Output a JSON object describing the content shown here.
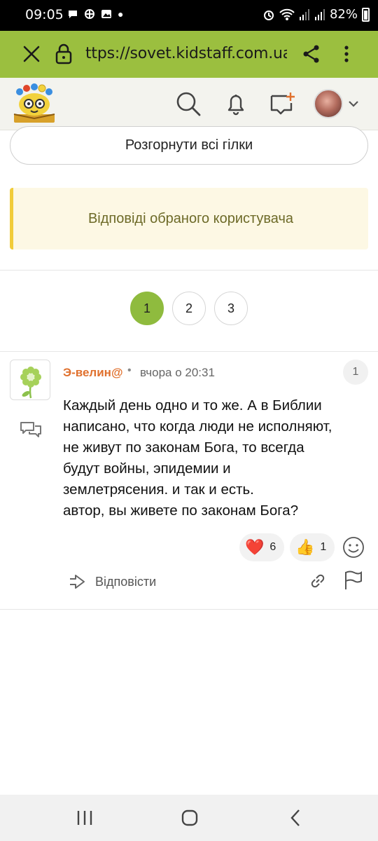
{
  "status_bar": {
    "time": "09:05",
    "battery": "82%",
    "notification_icons": [
      "chat-bubble-icon",
      "pinwheel-icon",
      "image-icon",
      "dot-icon"
    ],
    "system_icons": [
      "alarm-icon",
      "wifi-icon",
      "signal-icon",
      "signal-icon",
      "battery-icon"
    ]
  },
  "browser": {
    "url": "ttps://sovet.kidstaff.com.ua/a",
    "accent": "#9bbf3f"
  },
  "actions": {
    "expand_all": "Розгорнути всі гілки",
    "selected_user_replies": "Відповіді обраного користувача"
  },
  "pagination": {
    "pages": [
      "1",
      "2",
      "3"
    ],
    "current": "1"
  },
  "comment": {
    "author": "Э-велин@",
    "separator": "•",
    "time": "вчора о 20:31",
    "number": "1",
    "text_lines": [
      "Каждый день одно и то же. А в Библии",
      "написано, что когда люди не исполняют,",
      "не живут по законам Бога, то всегда",
      "будут войны, эпидемии и",
      "землетрясения. и так и есть.",
      "автор, вы живете по законам Бога?"
    ],
    "reactions": [
      {
        "emoji": "❤️",
        "count": "6"
      },
      {
        "emoji": "👍",
        "count": "1"
      }
    ],
    "reply_label": "Відповісти"
  },
  "colors": {
    "author": "#e0702d",
    "page_active": "#8fbb3e",
    "notice_bg": "#fdf8e4",
    "notice_border": "#f1cc3a"
  }
}
